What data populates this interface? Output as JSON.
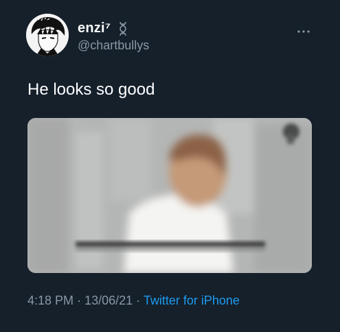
{
  "tweet": {
    "display_name": "enzi⁷",
    "name_emoji": "dna-icon",
    "handle": "@chartbullys",
    "text": "He looks so good",
    "time": "4:18 PM",
    "separator": "·",
    "date": "13/06/21",
    "source": "Twitter for iPhone",
    "more_icon": "ellipsis-icon"
  },
  "colors": {
    "background": "#15202b",
    "primary_text": "#ffffff",
    "secondary_text": "#8a98a6",
    "link": "#1d9bf0"
  }
}
